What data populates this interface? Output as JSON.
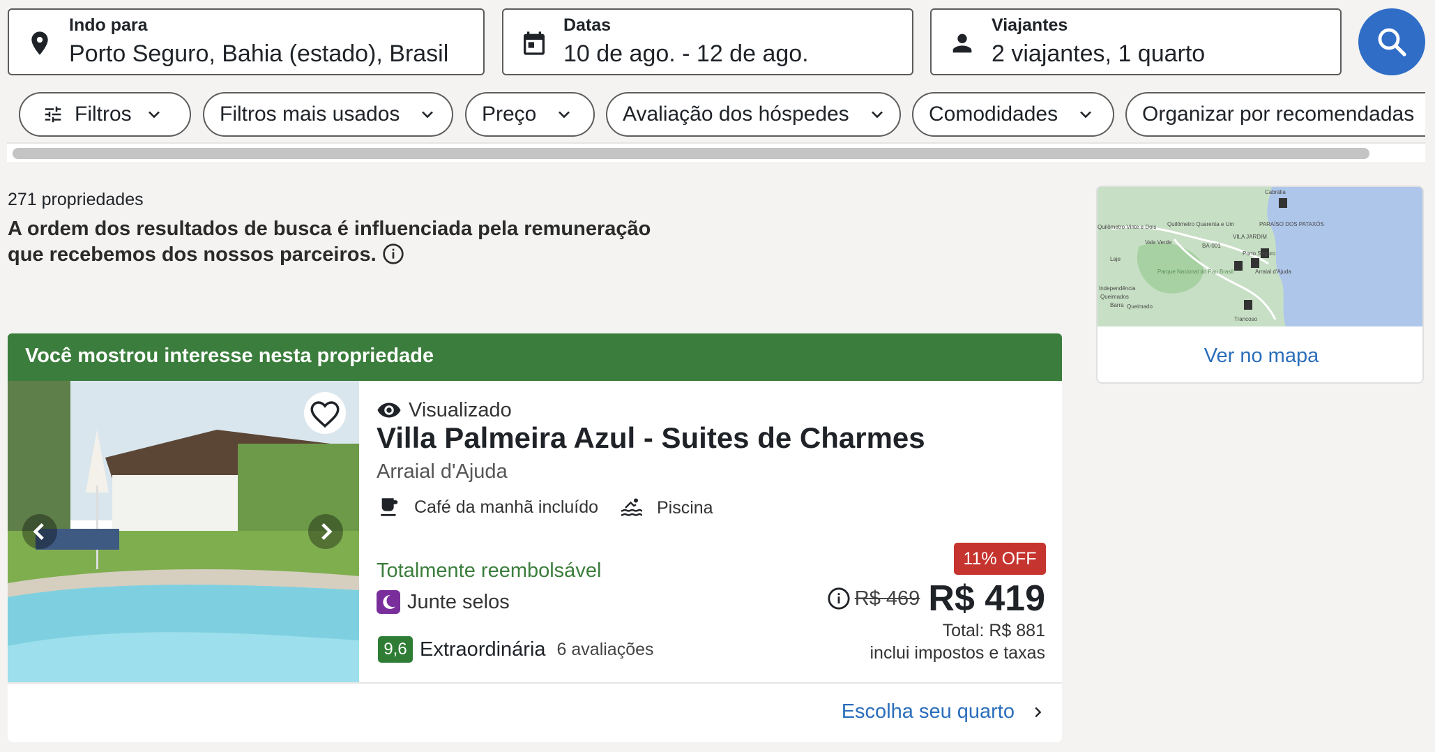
{
  "search": {
    "destination": {
      "label": "Indo para",
      "value": "Porto Seguro, Bahia (estado), Brasil",
      "icon": "location-pin-icon"
    },
    "dates": {
      "label": "Datas",
      "value": "10 de ago. - 12 de ago.",
      "icon": "calendar-icon"
    },
    "travelers": {
      "label": "Viajantes",
      "value": "2 viajantes, 1 quarto",
      "icon": "person-icon"
    },
    "search_button_icon": "search-icon"
  },
  "filters": [
    {
      "label": "Filtros"
    },
    {
      "label": "Filtros mais usados"
    },
    {
      "label": "Preço"
    },
    {
      "label": "Avaliação dos hóspedes"
    },
    {
      "label": "Comodidades"
    },
    {
      "label": "Organizar por recomendadas"
    }
  ],
  "results": {
    "count": "271 propriedades",
    "disclaimer": "A ordem dos resultados de busca é influenciada pela remuneração que recebemos dos nossos parceiros."
  },
  "map": {
    "link": "Ver no mapa",
    "labels": [
      "Cabrália",
      "Quilômetro Vinte e Dois",
      "Quilômetro Quarenta e Um",
      "PARAÍSO DOS PATAXÓS",
      "VILA JARDIM",
      "Porto Seguro",
      "Vale Verde",
      "Laje",
      "Parque Nacional do Pau Brasil",
      "Arraial d'Ajuda",
      "Independência",
      "Queimados",
      "Barra",
      "Queimado",
      "Trancoso",
      "BA-001"
    ]
  },
  "property": {
    "banner": "Você mostrou interesse nesta propriedade",
    "viewed": "Visualizado",
    "name": "Villa Palmeira Azul - Suites de Charmes",
    "location": "Arraial d'Ajuda",
    "amenities": [
      "Café da manhã incluído",
      "Piscina"
    ],
    "refund": "Totalmente reembolsável",
    "stamps": "Junte selos",
    "score": "9,6",
    "rating_label": "Extraordinária",
    "reviews": "6 avaliações",
    "discount": "11% OFF",
    "old_price": "R$ 469",
    "price": "R$ 419",
    "total": "Total: R$ 881",
    "taxes": "inclui impostos e taxas",
    "cta": "Escolha seu quarto"
  },
  "colors": {
    "accent": "#2f6dc7",
    "banner": "#3b7d3c",
    "discount": "#c6342f",
    "score": "#2f7d35",
    "link": "#2a6ebb"
  }
}
